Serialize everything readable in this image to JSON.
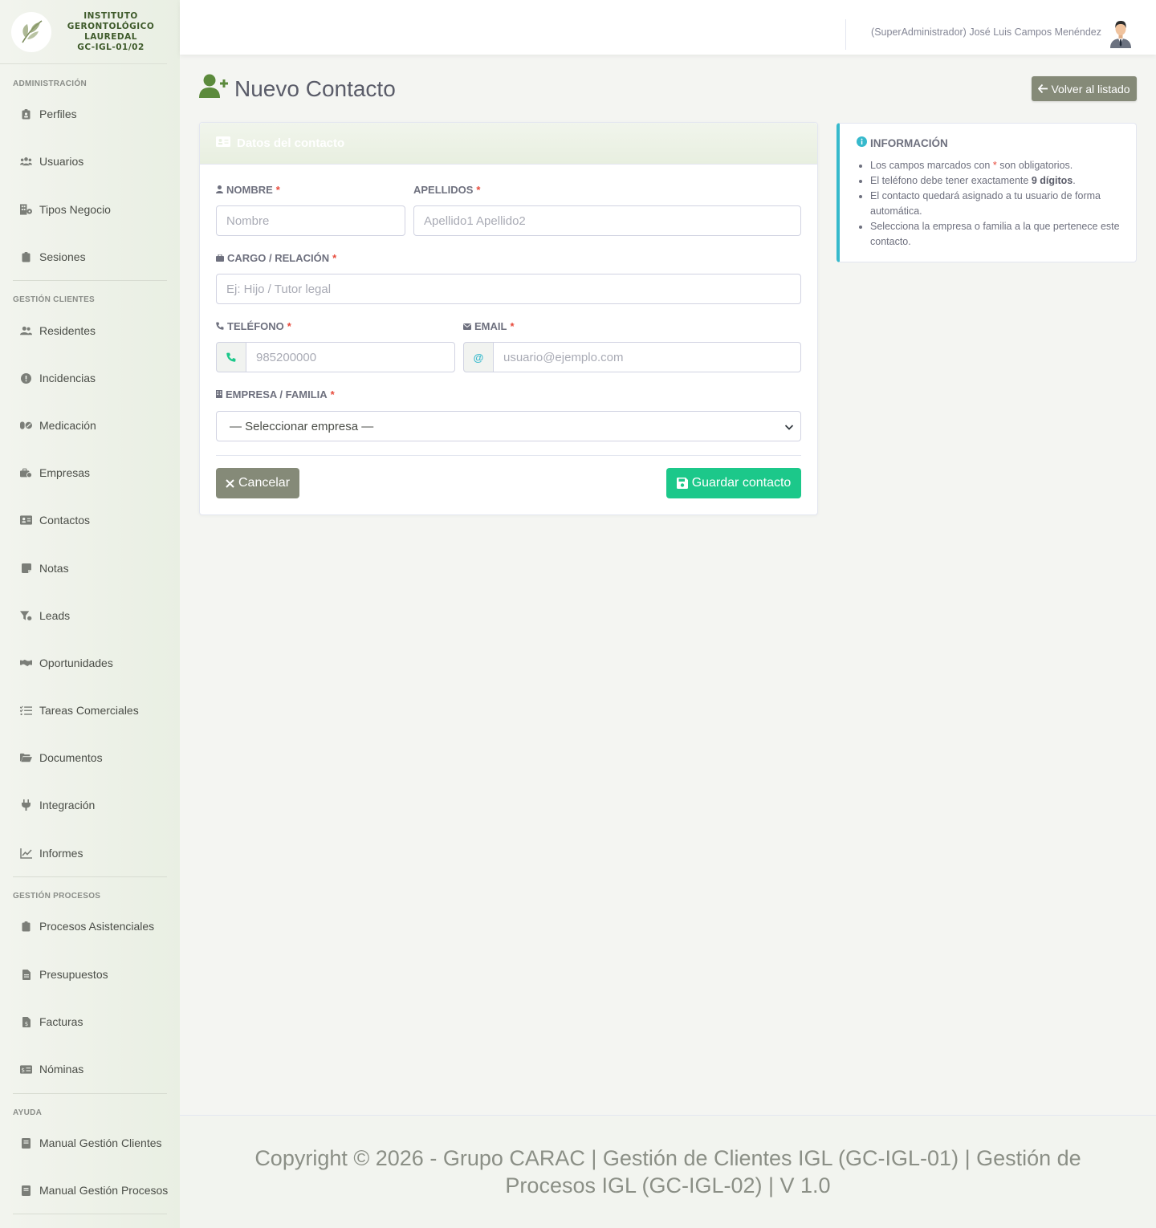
{
  "brand": {
    "lines": [
      "INSTITUTO",
      "GERONTOLÓGICO",
      "LAUREDAL",
      "GC-IGL-01/02"
    ]
  },
  "sidebar": {
    "sections": [
      {
        "heading": "ADMINISTRACIÓN",
        "items": [
          {
            "label": "Perfiles",
            "icon": "id-badge-icon"
          },
          {
            "label": "Usuarios",
            "icon": "users-icon"
          },
          {
            "label": "Tipos Negocio",
            "icon": "building-icon"
          },
          {
            "label": "Sesiones",
            "icon": "clipboard-icon"
          }
        ]
      },
      {
        "heading": "GESTIÓN CLIENTES",
        "items": [
          {
            "label": "Residentes",
            "icon": "user-group-icon"
          },
          {
            "label": "Incidencias",
            "icon": "alert-circle-icon"
          },
          {
            "label": "Medicación",
            "icon": "pills-icon"
          },
          {
            "label": "Empresas",
            "icon": "briefcase-icon"
          },
          {
            "label": "Contactos",
            "icon": "address-card-icon"
          },
          {
            "label": "Notas",
            "icon": "note-icon"
          },
          {
            "label": "Leads",
            "icon": "funnel-icon"
          },
          {
            "label": "Oportunidades",
            "icon": "handshake-icon"
          },
          {
            "label": "Tareas Comerciales",
            "icon": "task-list-icon"
          },
          {
            "label": "Documentos",
            "icon": "folder-open-icon"
          },
          {
            "label": "Integración",
            "icon": "plug-icon"
          },
          {
            "label": "Informes",
            "icon": "chart-line-icon"
          }
        ]
      },
      {
        "heading": "GESTIÓN PROCESOS",
        "items": [
          {
            "label": "Procesos Asistenciales",
            "icon": "clipboard-icon"
          },
          {
            "label": "Presupuestos",
            "icon": "file-icon"
          },
          {
            "label": "Facturas",
            "icon": "invoice-icon"
          },
          {
            "label": "Nóminas",
            "icon": "money-check-icon"
          }
        ]
      },
      {
        "heading": "AYUDA",
        "items": [
          {
            "label": "Manual Gestión Clientes",
            "icon": "book-icon"
          },
          {
            "label": "Manual Gestión Procesos",
            "icon": "book-icon"
          }
        ]
      }
    ]
  },
  "topbar": {
    "user": "(SuperAdministrador) José Luis Campos Menéndez"
  },
  "page": {
    "title": "Nuevo Contacto",
    "back_label": "Volver al listado"
  },
  "form": {
    "card_title": "Datos del contacto",
    "nombre": {
      "label": "NOMBRE",
      "placeholder": "Nombre"
    },
    "apellidos": {
      "label": "APELLIDOS",
      "placeholder": "Apellido1 Apellido2"
    },
    "cargo": {
      "label": "CARGO / RELACIÓN",
      "placeholder": "Ej: Hijo / Tutor legal"
    },
    "telefono": {
      "label": "TELÉFONO",
      "placeholder": "985200000"
    },
    "email": {
      "label": "EMAIL",
      "addon": "@",
      "placeholder": "usuario@ejemplo.com"
    },
    "empresa": {
      "label": "EMPRESA / FAMILIA",
      "selected": "— Seleccionar empresa —"
    },
    "required_mark": "*",
    "cancel_label": "Cancelar",
    "save_label": "Guardar contacto"
  },
  "info": {
    "title": "INFORMACIÓN",
    "item1_a": "Los campos marcados con",
    "item1_star": "*",
    "item1_b": "son obligatorios.",
    "item2_a": "El teléfono debe tener exactamente",
    "item2_bold": "9 dígitos",
    "item2_b": ".",
    "item3": "El contacto quedará asignado a tu usuario de forma automática.",
    "item4": "Selecciona la empresa o familia a la que pertenece este contacto."
  },
  "footer": {
    "text": "Copyright © 2026 - Grupo CARAC | Gestión de Clientes IGL (GC-IGL-01) | Gestión de Procesos IGL (GC-IGL-02) | V 1.0"
  },
  "colors": {
    "accent_green": "#1cc88a",
    "brand_green": "#5b8a3c",
    "info_cyan": "#36b9cc",
    "secondary": "#858a78",
    "required": "#e74a3b"
  }
}
